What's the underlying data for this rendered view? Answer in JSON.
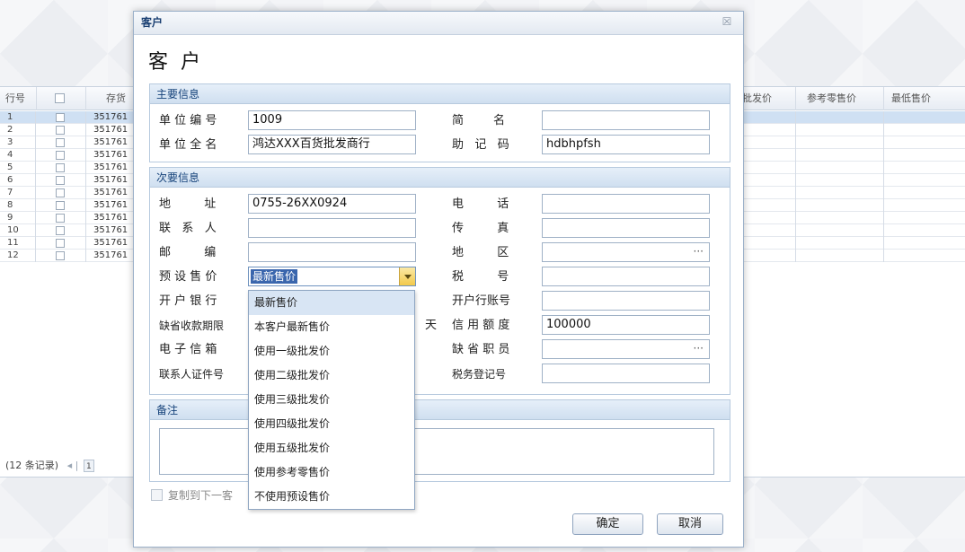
{
  "grid": {
    "headers": {
      "row_no": "行号",
      "code": "存货",
      "wholesale": "批发价",
      "retail": "参考零售价",
      "min_price": "最低售价"
    },
    "rows": [
      {
        "no": "1",
        "code": "351761"
      },
      {
        "no": "2",
        "code": "351761"
      },
      {
        "no": "3",
        "code": "351761"
      },
      {
        "no": "4",
        "code": "351761"
      },
      {
        "no": "5",
        "code": "351761"
      },
      {
        "no": "6",
        "code": "351761"
      },
      {
        "no": "7",
        "code": "351761"
      },
      {
        "no": "8",
        "code": "351761"
      },
      {
        "no": "9",
        "code": "351761"
      },
      {
        "no": "10",
        "code": "351761"
      },
      {
        "no": "11",
        "code": "351761"
      },
      {
        "no": "12",
        "code": "351761"
      }
    ],
    "footer": {
      "records": "(12 条记录)",
      "page": "1"
    }
  },
  "dialog": {
    "title": "客户",
    "heading": "客户",
    "primary": {
      "section_title": "主要信息",
      "unit_code_label": "单 位 编 号",
      "unit_code_value": "1009",
      "short_name_label": "简        名",
      "short_name_value": "",
      "full_name_label": "单 位 全 名",
      "full_name_value": "鸿达XXX百货批发商行",
      "mnemonic_label": "助   记   码",
      "mnemonic_value": "hdbhpfsh"
    },
    "secondary": {
      "section_title": "次要信息",
      "address_label": "地         址",
      "address_value": "0755-26XX0924",
      "phone_label": "电         话",
      "contact_label": "联   系   人",
      "fax_label": "传         真",
      "zip_label": "邮         编",
      "region_label": "地         区",
      "price_label": "预 设 售 价",
      "price_value": "最新售价",
      "tax_no_label": "税         号",
      "bank_label": "开 户 银 行",
      "bank_account_label": "开户行账号",
      "payment_days_label": "缺省收款期限",
      "payment_days_unit": "天",
      "credit_label": "信 用 额 度",
      "credit_value": "100000",
      "email_label": "电 子 信 箱",
      "default_staff_label": "缺 省 职 员",
      "contact_id_label": "联系人证件号",
      "tax_reg_label": "税务登记号"
    },
    "price_options": [
      "最新售价",
      "本客户最新售价",
      "使用一级批发价",
      "使用二级批发价",
      "使用三级批发价",
      "使用四级批发价",
      "使用五级批发价",
      "使用参考零售价",
      "不使用预设售价"
    ],
    "remarks_title": "备注",
    "copy_label": "复制到下一客",
    "ok_label": "确定",
    "cancel_label": "取消",
    "close_symbol": "☒"
  }
}
